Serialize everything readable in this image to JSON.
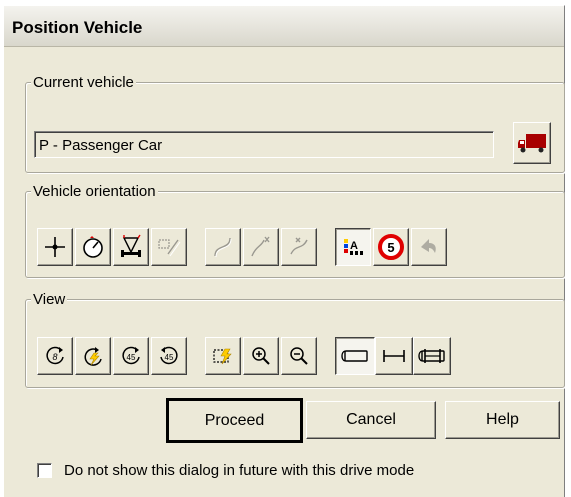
{
  "window": {
    "title": "Position Vehicle"
  },
  "current_vehicle": {
    "group_label": "Current vehicle",
    "value": "P - Passenger Car",
    "select_icon": "truck-icon"
  },
  "orientation": {
    "group_label": "Vehicle orientation",
    "tools": [
      {
        "name": "crosshair-icon",
        "enabled": true
      },
      {
        "name": "rotate-dial-icon",
        "enabled": true
      },
      {
        "name": "steer-angle-icon",
        "enabled": true
      },
      {
        "name": "rear-position-icon",
        "enabled": false
      },
      {
        "name": "path-icon-1",
        "enabled": false
      },
      {
        "name": "path-icon-2",
        "enabled": false
      },
      {
        "name": "path-icon-3",
        "enabled": false
      },
      {
        "name": "color-label-icon",
        "enabled": true,
        "pressed": true
      },
      {
        "name": "speed-sign-icon",
        "enabled": true,
        "label": "5"
      },
      {
        "name": "undo-icon",
        "enabled": false
      }
    ]
  },
  "view": {
    "group_label": "View",
    "tools": [
      {
        "name": "rotate-view-icon",
        "enabled": true
      },
      {
        "name": "rotate-bolt-icon",
        "enabled": true
      },
      {
        "name": "rotate-45-left-icon",
        "enabled": true,
        "label": "45"
      },
      {
        "name": "rotate-45-right-icon",
        "enabled": true,
        "label": "45"
      },
      {
        "name": "zoom-bolt-icon",
        "enabled": true
      },
      {
        "name": "zoom-in-icon",
        "enabled": true
      },
      {
        "name": "zoom-out-icon",
        "enabled": true
      },
      {
        "name": "view-body-icon",
        "enabled": true,
        "pressed": true
      },
      {
        "name": "view-axle-icon",
        "enabled": true
      },
      {
        "name": "view-full-icon",
        "enabled": true
      }
    ]
  },
  "buttons": {
    "proceed": "Proceed",
    "cancel": "Cancel",
    "help": "Help"
  },
  "checkbox": {
    "label": "Do not show this dialog in future with this drive mode",
    "checked": false
  },
  "colors": {
    "dialog_bg": "#ece9d8",
    "truck_red": "#a80000",
    "sign_red": "#e00000"
  }
}
